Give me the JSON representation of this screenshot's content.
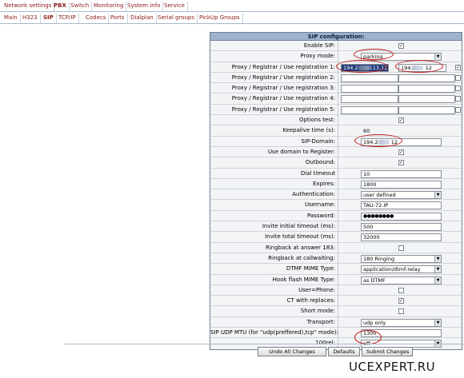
{
  "top_tabs": [
    {
      "label": "Network settings",
      "active": false
    },
    {
      "label": "PBX",
      "active": true
    },
    {
      "label": "Switch",
      "active": false
    },
    {
      "label": "Monitoring",
      "active": false
    },
    {
      "label": "System info",
      "active": false
    },
    {
      "label": "Service",
      "active": false
    }
  ],
  "sub_tabs": [
    {
      "label": "Main",
      "active": false
    },
    {
      "label": "H323",
      "active": false
    },
    {
      "label": "SIP",
      "active": true
    },
    {
      "label": "TCP/IP",
      "active": false
    },
    {
      "label": "Codecs",
      "active": false
    },
    {
      "label": "Ports",
      "active": false
    },
    {
      "label": "Dialplan",
      "active": false
    },
    {
      "label": "Serial groups",
      "active": false
    },
    {
      "label": "PickUp Groups",
      "active": false
    }
  ],
  "form": {
    "title": "SIP configuration:",
    "enable_sip": {
      "label": "Enable SIP:",
      "checked": true
    },
    "proxy_mode": {
      "label": "Proxy mode:",
      "value": "parking"
    },
    "registrars": [
      {
        "label": "Proxy / Registrar / Use registration 1:",
        "proxy": "194.2",
        "proxy_suffix": "113.12",
        "registrar": "194.",
        "registrar_suffix": "12",
        "use": true
      },
      {
        "label": "Proxy / Registrar / Use registration 2:",
        "proxy": "",
        "registrar": "",
        "use": false
      },
      {
        "label": "Proxy / Registrar / Use registration 3:",
        "proxy": "",
        "registrar": "",
        "use": false
      },
      {
        "label": "Proxy / Registrar / Use registration 4:",
        "proxy": "",
        "registrar": "",
        "use": false
      },
      {
        "label": "Proxy / Registrar / Use registration 5:",
        "proxy": "",
        "registrar": "",
        "use": false
      }
    ],
    "options_test": {
      "label": "Options test:",
      "checked": true
    },
    "keepalive": {
      "label": "Keepalive time (s):",
      "value": "60"
    },
    "sip_domain": {
      "label": "SIP-Domain:",
      "value": "194.2",
      "suffix": "12"
    },
    "use_domain": {
      "label": "Use domain to Register:",
      "checked": true
    },
    "outbound": {
      "label": "Outbound:",
      "checked": true
    },
    "dial_timeout": {
      "label": "Dial timeout",
      "value": "10"
    },
    "expires": {
      "label": "Expires:",
      "value": "1800"
    },
    "authentication": {
      "label": "Authentication:",
      "value": "user defined"
    },
    "username": {
      "label": "Username:",
      "value": "TAU-72.IP"
    },
    "password": {
      "label": "Password:",
      "value": "●●●●●●●●"
    },
    "invite_initial": {
      "label": "Invite initial timeout (ms):",
      "value": "500"
    },
    "invite_total": {
      "label": "Invite total timeout (ms):",
      "value": "32000"
    },
    "ringback_183": {
      "label": "Ringback at answer 183:",
      "checked": false
    },
    "ringback_callwaiting": {
      "label": "Ringback at callwaiting:",
      "value": "180 Ringing"
    },
    "dtmf_mime": {
      "label": "DTMF MIME Type:",
      "value": "application/dtmf-relay"
    },
    "hookflash_mime": {
      "label": "Hook flash MIME Type:",
      "value": "as DTMF"
    },
    "user_phone": {
      "label": "User=Phone:",
      "checked": false
    },
    "ct_replaces": {
      "label": "CT with replaces:",
      "checked": true
    },
    "short_mode": {
      "label": "Short mode:",
      "checked": false
    },
    "transport": {
      "label": "Transport:",
      "value": "udp only"
    },
    "udp_mtu": {
      "label": "SIP UDP MTU (for \"udp(preffered),tcp\" mode):",
      "value": "1300"
    },
    "rel100": {
      "label": "100rel:",
      "value": "off"
    }
  },
  "buttons": {
    "undo": "Undo All Changes",
    "defaults": "Defaults",
    "submit": "Submit Changes"
  },
  "watermark": "UCEXPERT.RU",
  "colors": {
    "tab_text": "#8b1a1a",
    "header_bg": "#9fb2cb",
    "annotation_ring": "#c01818"
  }
}
